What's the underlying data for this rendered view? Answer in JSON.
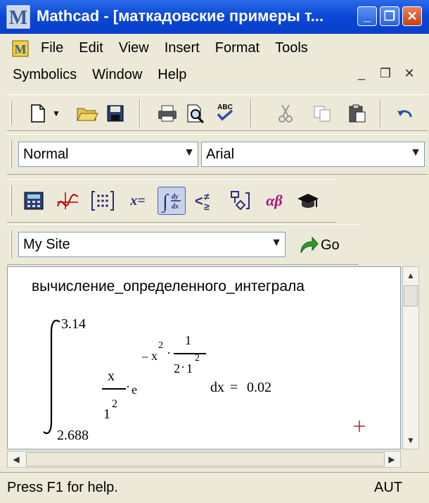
{
  "window": {
    "title": "Mathcad - [маткадовские примеры т...",
    "controls": [
      "_",
      "❐",
      "✕"
    ]
  },
  "menu": {
    "row1": [
      "File",
      "Edit",
      "View",
      "Insert",
      "Format",
      "Tools"
    ],
    "row2": [
      "Symbolics",
      "Window",
      "Help"
    ],
    "mdi_controls": [
      "_",
      "❐",
      "✕"
    ]
  },
  "formatting": {
    "style": "Normal",
    "font": "Arial"
  },
  "address": {
    "value": "My Site",
    "go_label": "Go"
  },
  "worksheet": {
    "title": "вычисление_определенного_интеграла",
    "integral": {
      "upper_limit": "3.14",
      "lower_limit": "2.688",
      "numerator": "x",
      "denominator_base": "1",
      "denominator_exp": "2",
      "e": "e",
      "exp_minus": "−",
      "exp_x": "x",
      "exp_x_pow": "2",
      "exp_frac_num": "1",
      "exp_frac_den_a": "2",
      "exp_frac_den_b": "1",
      "exp_frac_den_pow": "2",
      "differential": "dx",
      "equals": "=",
      "result": "0.02"
    }
  },
  "status": {
    "message": "Press F1 for help.",
    "mode": "AUT"
  },
  "icons": [
    "mathcad-app-icon",
    "document-icon",
    "new-file-icon",
    "open-folder-icon",
    "save-icon",
    "print-icon",
    "print-preview-icon",
    "spell-check-icon",
    "cut-icon",
    "copy-icon",
    "paste-icon",
    "undo-icon",
    "calculator-icon",
    "graph-icon",
    "matrix-icon",
    "evaluation-icon",
    "calculus-icon",
    "boolean-icon",
    "programming-icon",
    "greek-icon",
    "symbolic-icon",
    "go-arrow-icon",
    "cursor-cross-icon"
  ]
}
